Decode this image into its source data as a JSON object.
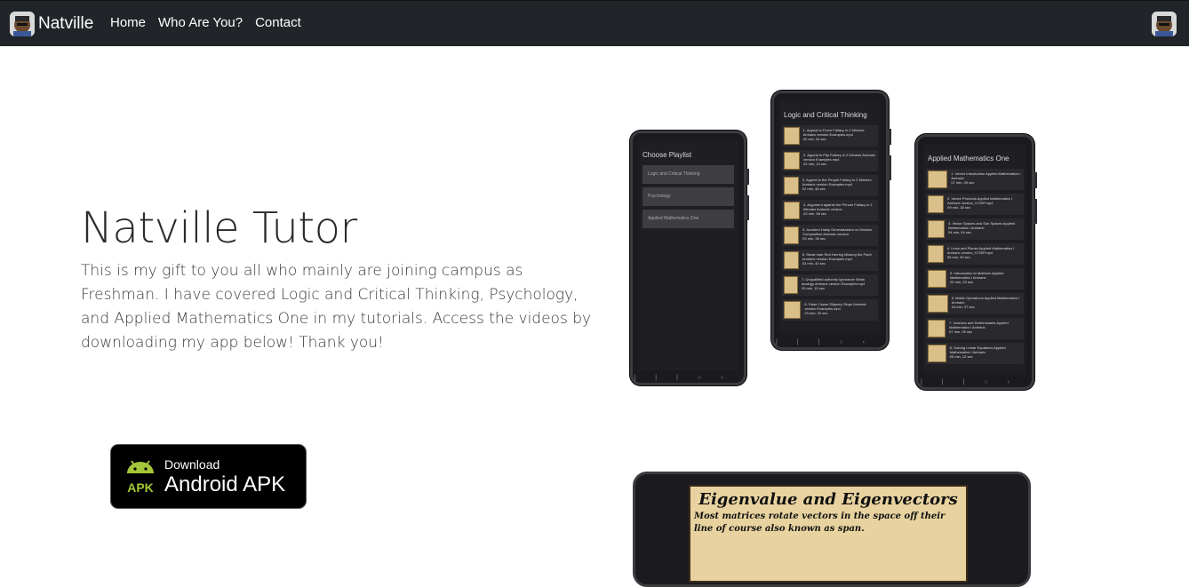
{
  "nav": {
    "brand": "Natville",
    "links": [
      "Home",
      "Who Are You?",
      "Contact"
    ]
  },
  "hero": {
    "title": "Natville Tutor",
    "text": "This is my gift to you all who mainly are joining campus as Freshman. I have covered Logic and Critical Thinking, Psychology, and Applied Mathematics One in my tutorials. Access the videos by downloading my app below! Thank you!"
  },
  "apk_button": {
    "small": "Download",
    "big": "Android APK",
    "icon_label": "APK",
    "icon": "android-icon",
    "color": "#a4c639"
  },
  "phones": {
    "left": {
      "title": "Choose Playlist",
      "items": [
        "Logic and Critical Thinking",
        "Psychology",
        "Applied Mathematics One"
      ]
    },
    "middle": {
      "title": "Logic and Critical Thinking",
      "videos": [
        {
          "title": "1. Appeal to Force Fallacy in 2 Minutes Amharic version Examples.mp4",
          "duration": "02 min, 26 sec"
        },
        {
          "title": "2. Appeal to Pity Fallacy in 2 Minutes Amharic version Examples.mp4",
          "duration": "02 min, 13 sec"
        },
        {
          "title": "3. Appeal to the People Fallacy in 2 Minutes Amharic version Examples.mp4",
          "duration": "02 min, 46 sec"
        },
        {
          "title": "4. Argument against the Person Fallacy in 2 Minutes Amharic version",
          "duration": "02 min, 56 sec"
        },
        {
          "title": "5. Accident Hasty Generalization vs Division Composition Amharic version",
          "duration": "03 min, 36 sec"
        },
        {
          "title": "6. Straw man Red Herring Missing the Point Amharic version Examples.mp4",
          "duration": "03 min, 40 sec"
        },
        {
          "title": "7. Unqualified authority Ignorance Weak analogy Amharic version Examples.mp4",
          "duration": "03 min, 15 sec"
        },
        {
          "title": "8. False Cause Slippery Slope Amharic version Examples.mp4",
          "duration": "03 min, 40 sec"
        }
      ]
    },
    "right": {
      "title": "Applied Mathematics One",
      "videos": [
        {
          "title": "1. Vector Introduction Applied Mathematics I Amharic",
          "duration": "07 min, 39 sec"
        },
        {
          "title": "2. Vector Products Applied Mathematics I Amharic version_V720P.mp4",
          "duration": "09 min, 38 sec"
        },
        {
          "title": "3. Vector Spaces and Sub Spaces Applied Mathematics I Amharic",
          "duration": "04 min, 54 sec"
        },
        {
          "title": "4. Lines and Planes Applied Mathematics I Amharic version_V720P.mp4",
          "duration": "05 min, 49 sec"
        },
        {
          "title": "5. Introduction to Matrices Applied Mathematics I Amharic",
          "duration": "02 min, 33 sec"
        },
        {
          "title": "6. Matrix Operations Applied Mathematics I Amharic",
          "duration": "04 min, 37 sec"
        },
        {
          "title": "7. Inverses and Determinants Applied Mathematics I Amharic",
          "duration": "07 min, 05 sec"
        },
        {
          "title": "8. Solving Linear Equations Applied Mathematics I Amharic",
          "duration": "05 min, 12 sec"
        }
      ]
    },
    "landscape": {
      "title": "Eigenvalue and Eigenvectors",
      "body": "Most matrices rotate vectors in the space off their line of course also known as span."
    }
  }
}
